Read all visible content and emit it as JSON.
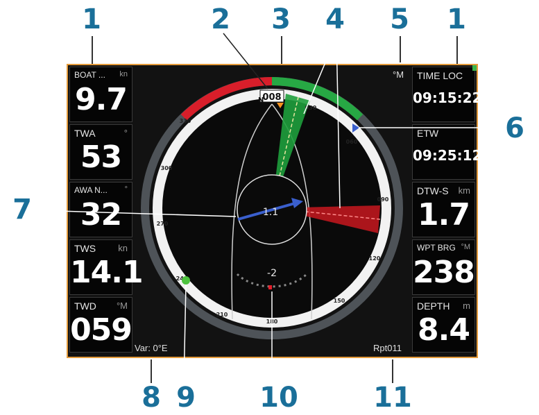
{
  "callouts": [
    "1",
    "2",
    "3",
    "4",
    "5",
    "1",
    "6",
    "7",
    "8",
    "9",
    "10",
    "11"
  ],
  "left_tiles": [
    {
      "label": "BOAT ...",
      "unit": "kn",
      "value": "9.7"
    },
    {
      "label": "TWA",
      "unit": "°",
      "value": "53"
    },
    {
      "label": "AWA N...",
      "unit": "°",
      "value": "32"
    },
    {
      "label": "TWS",
      "unit": "kn",
      "value": "14.1"
    },
    {
      "label": "TWD",
      "unit": "°M",
      "value": "059"
    }
  ],
  "right_tiles": [
    {
      "label": "TIME LOC",
      "unit": "",
      "value": "09:15:22"
    },
    {
      "label": "ETW",
      "unit": "",
      "value": "09:25:12"
    },
    {
      "label": "DTW-S",
      "unit": "km",
      "value": "1.7"
    },
    {
      "label": "WPT BRG",
      "unit": "°M",
      "value": "238"
    },
    {
      "label": "DEPTH",
      "unit": "m",
      "value": "8.4"
    }
  ],
  "gauge": {
    "heading": "008",
    "north_label": "N",
    "heading_unit": "°M",
    "ticks": [
      "030",
      "060",
      "090",
      "120",
      "150",
      "180",
      "210",
      "240",
      "270",
      "300",
      "330"
    ],
    "center_value": "1.1",
    "lower_value": "-2",
    "var_text": "Var: 0°E",
    "repeater_text": "Rpt011"
  },
  "colors": {
    "accent": "#1a6f99",
    "frame": "#e49a3a",
    "port": "#d81e2a",
    "starboard": "#27a844",
    "wind_arrow": "#3a5fcd"
  }
}
